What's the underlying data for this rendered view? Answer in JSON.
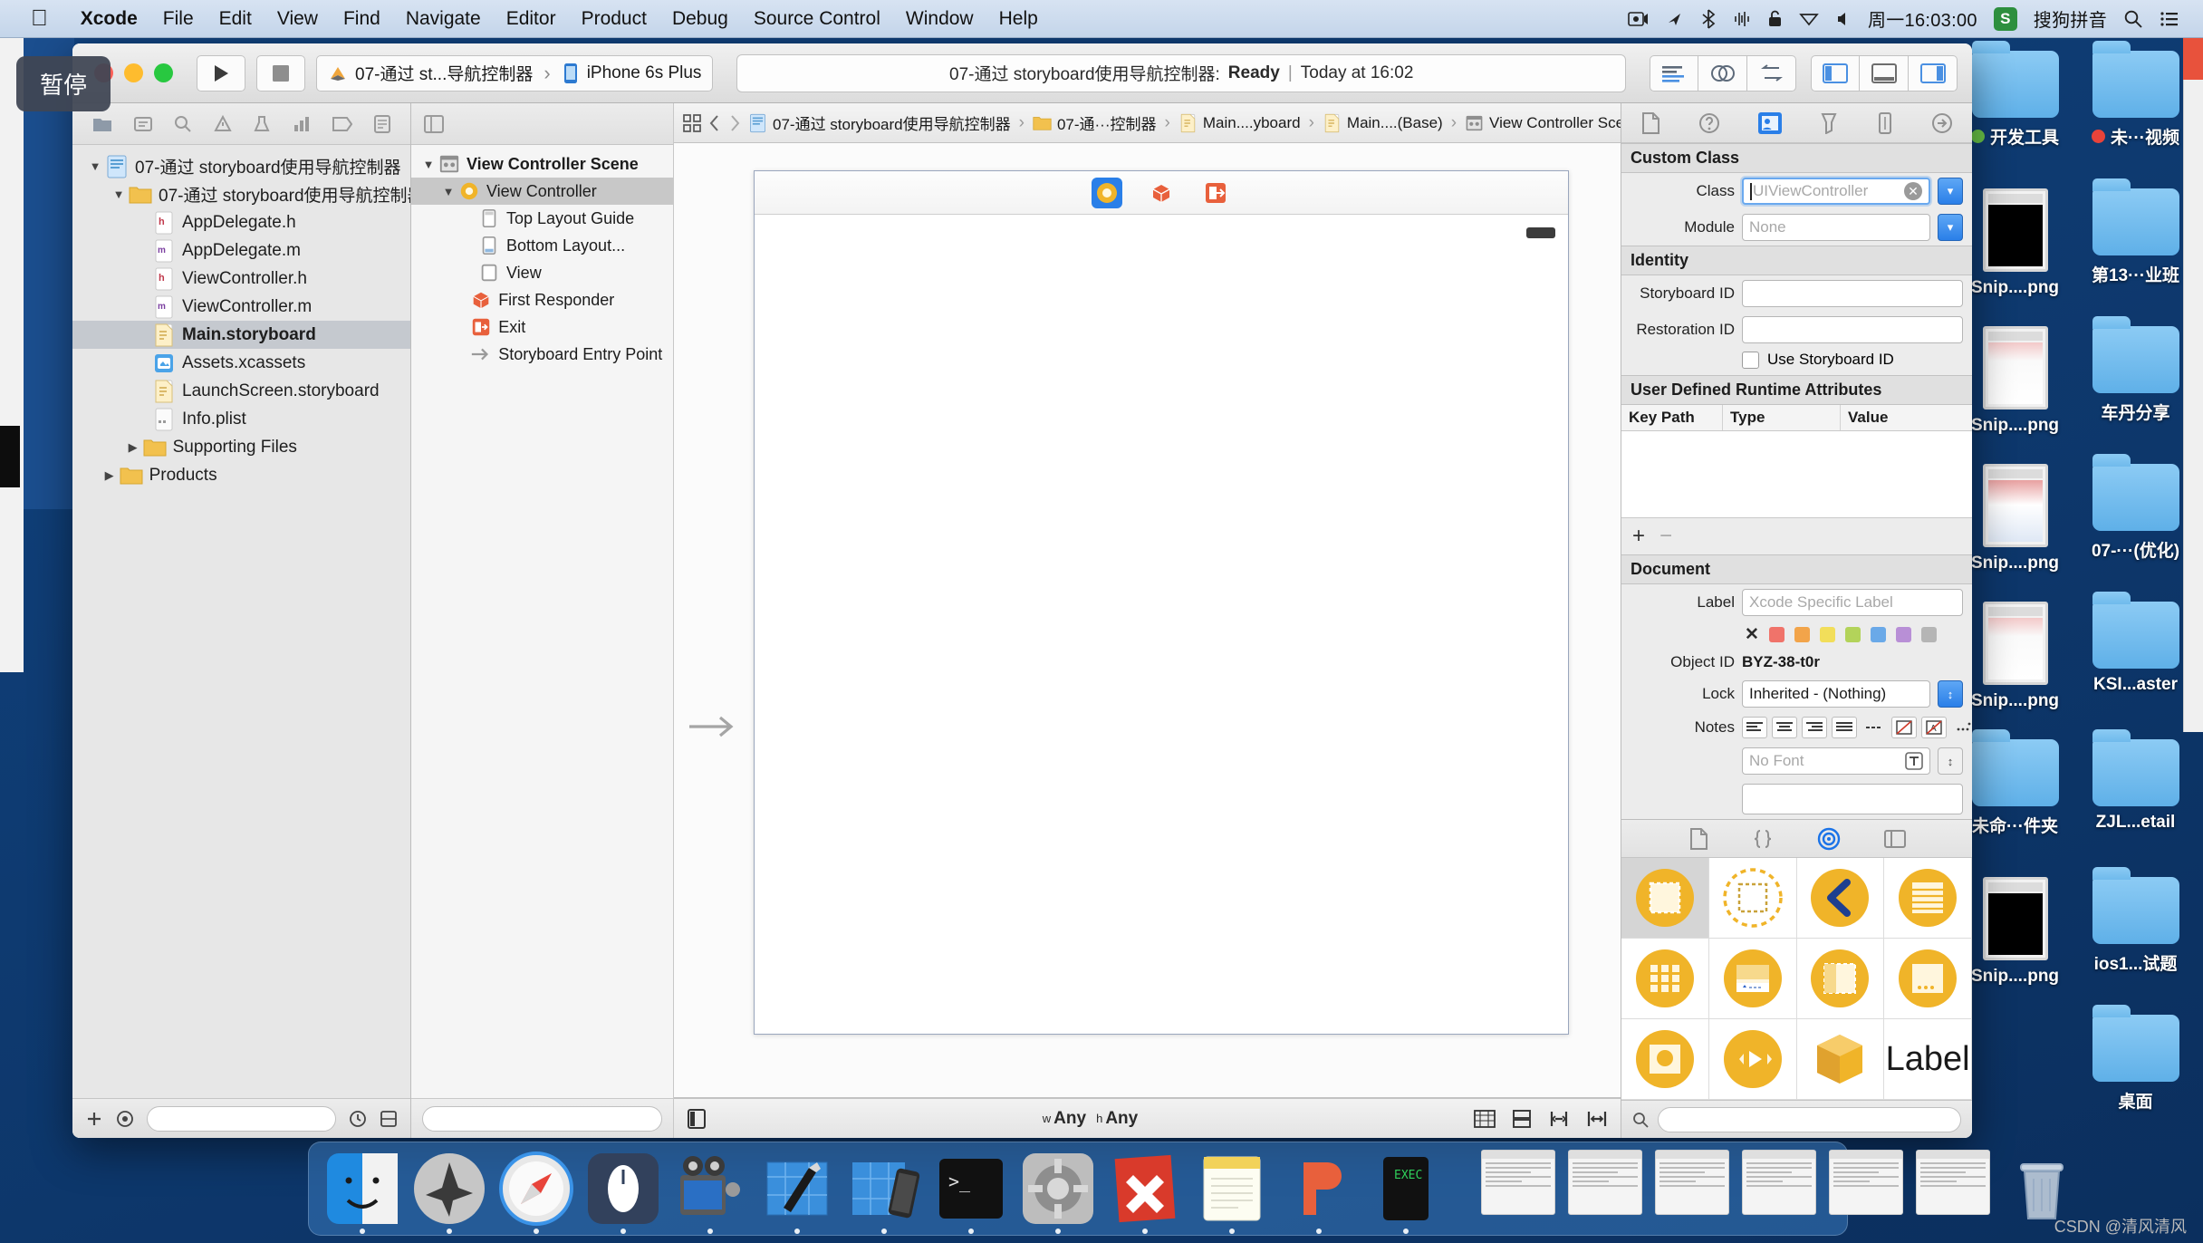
{
  "menubar": {
    "apple_icon": "apple-icon",
    "items": [
      {
        "label": "Xcode",
        "bold": true
      },
      {
        "label": "File",
        "bold": false
      },
      {
        "label": "Edit",
        "bold": false
      },
      {
        "label": "View",
        "bold": false
      },
      {
        "label": "Find",
        "bold": false
      },
      {
        "label": "Navigate",
        "bold": false
      },
      {
        "label": "Editor",
        "bold": false
      },
      {
        "label": "Product",
        "bold": false
      },
      {
        "label": "Debug",
        "bold": false
      },
      {
        "label": "Source Control",
        "bold": false
      },
      {
        "label": "Window",
        "bold": false
      },
      {
        "label": "Help",
        "bold": false
      }
    ],
    "status_icons": [
      "screen-record-icon",
      "airplay-icon",
      "bluetooth-icon",
      "sound-wave-icon",
      "lock-icon",
      "wifi-icon",
      "volume-icon"
    ],
    "clock": "周一16:03:00",
    "input_method_badge": "S",
    "input_method_label": "搜狗拼音",
    "search_icon": "search-icon",
    "notification_icon": "notification-center-icon"
  },
  "tooltip": {
    "text": "暂停"
  },
  "toolbar": {
    "traffic_lights": [
      "close",
      "minimize",
      "zoom"
    ],
    "run_button": "run-icon",
    "stop_button": "stop-icon",
    "scheme": {
      "target_icon": "xcode-project-icon",
      "target_label": "07-通过 st...导航控制器",
      "separator": "›",
      "device_icon": "iphone-icon",
      "device_label": "iPhone 6s Plus"
    },
    "status": {
      "project": "07-通过 storyboard使用导航控制器:",
      "state": "Ready",
      "divider": "|",
      "time": "Today at 16:02"
    },
    "editor_buttons": [
      "standard-editor-icon",
      "assistant-editor-icon",
      "version-editor-icon"
    ],
    "view_buttons": [
      "hide-navigator-icon",
      "hide-debug-area-icon",
      "hide-utilities-icon"
    ]
  },
  "navigator": {
    "tabs": [
      "project-navigator-icon",
      "symbol-navigator-icon",
      "find-navigator-icon",
      "issue-navigator-icon",
      "test-navigator-icon",
      "debug-navigator-icon",
      "breakpoint-navigator-icon",
      "report-navigator-icon"
    ],
    "tree": [
      {
        "label": "07-通过 storyboard使用导航控制器",
        "indent": 0,
        "twisty": "▼",
        "icon": "xcode-project-icon",
        "selected": false,
        "bold": false
      },
      {
        "label": "07-通过 storyboard使用导航控制器",
        "indent": 1,
        "twisty": "▼",
        "icon": "folder-icon",
        "selected": false,
        "bold": false
      },
      {
        "label": "AppDelegate.h",
        "indent": 2,
        "twisty": "",
        "icon": "header-file-icon",
        "selected": false,
        "bold": false
      },
      {
        "label": "AppDelegate.m",
        "indent": 2,
        "twisty": "",
        "icon": "source-file-icon",
        "selected": false,
        "bold": false
      },
      {
        "label": "ViewController.h",
        "indent": 2,
        "twisty": "",
        "icon": "header-file-icon",
        "selected": false,
        "bold": false
      },
      {
        "label": "ViewController.m",
        "indent": 2,
        "twisty": "",
        "icon": "source-file-icon",
        "selected": false,
        "bold": false
      },
      {
        "label": "Main.storyboard",
        "indent": 2,
        "twisty": "",
        "icon": "storyboard-file-icon",
        "selected": true,
        "bold": true
      },
      {
        "label": "Assets.xcassets",
        "indent": 2,
        "twisty": "",
        "icon": "assets-catalog-icon",
        "selected": false,
        "bold": false
      },
      {
        "label": "LaunchScreen.storyboard",
        "indent": 2,
        "twisty": "",
        "icon": "storyboard-file-icon",
        "selected": false,
        "bold": false
      },
      {
        "label": "Info.plist",
        "indent": 2,
        "twisty": "",
        "icon": "plist-file-icon",
        "selected": false,
        "bold": false
      },
      {
        "label": "Supporting Files",
        "indent": 1.6,
        "twisty": "▶",
        "icon": "folder-icon",
        "selected": false,
        "bold": false
      },
      {
        "label": "Products",
        "indent": 0.6,
        "twisty": "▶",
        "icon": "folder-icon",
        "selected": false,
        "bold": false
      }
    ],
    "bottom": {
      "add_icon": "add-icon",
      "filter_icon": "filter-icon",
      "filter_placeholder": "",
      "recent_icon": "recent-files-icon",
      "source-control_icon": "source-control-filter-icon"
    }
  },
  "outline": {
    "toolbar_icon": "document-outline-toggle-icon",
    "tree": [
      {
        "label": "View Controller Scene",
        "indent": 0,
        "twisty": "▼",
        "icon": "scene-icon",
        "selected": false,
        "bold": true
      },
      {
        "label": "View Controller",
        "indent": 1,
        "twisty": "▼",
        "icon": "view-controller-icon",
        "selected": true,
        "bold": false
      },
      {
        "label": "Top Layout Guide",
        "indent": 2,
        "twisty": "",
        "icon": "top-layout-guide-icon",
        "selected": false,
        "bold": false
      },
      {
        "label": "Bottom Layout...",
        "indent": 2,
        "twisty": "",
        "icon": "bottom-layout-guide-icon",
        "selected": false,
        "bold": false
      },
      {
        "label": "View",
        "indent": 2,
        "twisty": "",
        "icon": "view-icon",
        "selected": false,
        "bold": false
      },
      {
        "label": "First Responder",
        "indent": 1.6,
        "twisty": "",
        "icon": "first-responder-icon",
        "selected": false,
        "bold": false
      },
      {
        "label": "Exit",
        "indent": 1.6,
        "twisty": "",
        "icon": "exit-icon",
        "selected": false,
        "bold": false
      },
      {
        "label": "Storyboard Entry Point",
        "indent": 1.6,
        "twisty": "",
        "icon": "entry-point-arrow-icon",
        "selected": false,
        "bold": false
      }
    ],
    "filter_placeholder": ""
  },
  "jumpbar": {
    "grid_icon": "related-items-icon",
    "back_icon": "back-chevron-icon",
    "forward_icon": "forward-chevron-icon",
    "crumbs": [
      {
        "label": "07-通过 storyboard使用导航控制器",
        "icon": "xcode-project-icon"
      },
      {
        "label": "07-通···控制器",
        "icon": "folder-icon"
      },
      {
        "label": "Main....yboard",
        "icon": "storyboard-file-icon"
      },
      {
        "label": "Main....(Base)",
        "icon": "storyboard-file-icon"
      },
      {
        "label": "View Controller Scene",
        "icon": "scene-icon"
      },
      {
        "label": "View Controller",
        "icon": "view-controller-icon"
      }
    ],
    "separator": "›"
  },
  "canvas": {
    "entry_arrow": "storyboard-entry-arrow",
    "scene_dock": [
      {
        "icon": "view-controller-icon",
        "selected": true
      },
      {
        "icon": "first-responder-icon",
        "selected": false
      },
      {
        "icon": "exit-icon",
        "selected": false
      }
    ],
    "resize_handle": "resize-handle",
    "cursor": "mouse-pointer"
  },
  "editor_bottom": {
    "left_icon": "size-class-toggle-icon",
    "width_prefix": "w",
    "width_value": "Any",
    "height_prefix": "h",
    "height_value": "Any",
    "right_icons": [
      "constraints-icon",
      "embed-in-icon",
      "align-icon",
      "pin-icon"
    ]
  },
  "inspector": {
    "tabs": [
      "file-inspector-icon",
      "quick-help-icon",
      "identity-inspector-icon",
      "attributes-inspector-icon",
      "size-inspector-icon",
      "connections-inspector-icon"
    ],
    "active_tab_index": 2,
    "custom_class": {
      "title": "Custom Class",
      "class_label": "Class",
      "class_placeholder": "UIViewController",
      "class_value": "",
      "module_label": "Module",
      "module_placeholder": "None",
      "module_value": ""
    },
    "identity": {
      "title": "Identity",
      "storyboard_id_label": "Storyboard ID",
      "storyboard_id_value": "",
      "restoration_id_label": "Restoration ID",
      "restoration_id_value": "",
      "use_storyboard_id_label": "Use Storyboard ID",
      "use_storyboard_id_checked": false
    },
    "user_defined": {
      "title": "User Defined Runtime Attributes",
      "columns": [
        "Key Path",
        "Type",
        "Value"
      ],
      "rows": [],
      "add_icon": "plus-icon",
      "remove_icon": "minus-icon"
    },
    "document": {
      "title": "Document",
      "label_label": "Label",
      "label_placeholder": "Xcode Specific Label",
      "label_value": "",
      "swatch_clear": "✕",
      "swatches": [
        "#f0736a",
        "#f2a44a",
        "#f2de5a",
        "#b3d35a",
        "#6aa9e8",
        "#b88fd6",
        "#b5b5b5"
      ],
      "object_id_label": "Object ID",
      "object_id_value": "BYZ-38-t0r",
      "lock_label": "Lock",
      "lock_value": "Inherited - (Nothing)",
      "notes_label": "Notes",
      "notes_buttons": [
        "align-left-icon",
        "align-center-icon",
        "align-right-icon",
        "align-justify-icon",
        "list-icon",
        "no-color-icon",
        "no-text-color-icon",
        "more-icon"
      ],
      "font_placeholder": "No Font",
      "font_button_icon": "font-panel-icon",
      "notes_text": ""
    }
  },
  "library": {
    "tabs": [
      "file-template-library-icon",
      "code-snippet-library-icon",
      "object-library-icon",
      "media-library-icon"
    ],
    "active_tab_index": 2,
    "items": [
      {
        "name": "view-controller-object",
        "selected": true
      },
      {
        "name": "storyboard-reference-object",
        "selected": false
      },
      {
        "name": "navigation-controller-object",
        "selected": false
      },
      {
        "name": "table-view-controller-object",
        "selected": false
      },
      {
        "name": "collection-view-controller-object",
        "selected": false
      },
      {
        "name": "tab-bar-controller-object",
        "selected": false
      },
      {
        "name": "split-view-controller-object",
        "selected": false
      },
      {
        "name": "page-view-controller-object",
        "selected": false
      },
      {
        "name": "glkit-view-controller-object",
        "selected": false
      },
      {
        "name": "avkit-player-controller-object",
        "selected": false
      },
      {
        "name": "object-cube",
        "selected": false
      },
      {
        "name": "label-object",
        "selected": false,
        "text": "Label"
      }
    ],
    "filter_placeholder": "",
    "filter_icon": "search-icon"
  },
  "desktop": {
    "icons": [
      {
        "label": "开发工具",
        "type": "folder",
        "tag": "#69c447"
      },
      {
        "label": "未···视频",
        "type": "folder",
        "tag": "#e8433a"
      },
      {
        "label": "Snip....png",
        "type": "png-dark",
        "tag": ""
      },
      {
        "label": "第13···业班",
        "type": "folder",
        "tag": ""
      },
      {
        "label": "Snip....png",
        "type": "png-light",
        "tag": ""
      },
      {
        "label": "车丹分享",
        "type": "folder",
        "tag": ""
      },
      {
        "label": "Snip....png",
        "type": "png-mixed",
        "tag": ""
      },
      {
        "label": "07-···(优化)",
        "type": "folder",
        "tag": ""
      },
      {
        "label": "Snip....png",
        "type": "png-light",
        "tag": ""
      },
      {
        "label": "KSI...aster",
        "type": "folder",
        "tag": ""
      },
      {
        "label": "未命···件夹",
        "type": "folder",
        "tag": ""
      },
      {
        "label": "ZJL...etail",
        "type": "folder",
        "tag": ""
      },
      {
        "label": "Snip....png",
        "type": "png-dark",
        "tag": ""
      },
      {
        "label": "ios1...试题",
        "type": "folder",
        "tag": ""
      },
      {
        "label": "",
        "type": "none",
        "tag": ""
      },
      {
        "label": "桌面",
        "type": "folder",
        "tag": ""
      }
    ]
  },
  "dock": {
    "apps": [
      {
        "name": "finder-icon"
      },
      {
        "name": "launchpad-icon"
      },
      {
        "name": "safari-icon"
      },
      {
        "name": "mouse-app-icon"
      },
      {
        "name": "quicktime-icon"
      },
      {
        "name": "xcode-icon"
      },
      {
        "name": "simulator-icon"
      },
      {
        "name": "terminal-icon"
      },
      {
        "name": "system-preferences-icon"
      },
      {
        "name": "xmind-icon"
      },
      {
        "name": "notes-icon"
      },
      {
        "name": "pages-icon"
      },
      {
        "name": "exec-icon"
      }
    ],
    "minimized": [
      {
        "name": "minimized-window-1"
      },
      {
        "name": "minimized-window-2"
      },
      {
        "name": "minimized-window-3"
      },
      {
        "name": "minimized-window-4"
      },
      {
        "name": "minimized-window-5"
      },
      {
        "name": "minimized-window-6"
      }
    ],
    "trash": {
      "name": "trash-icon"
    }
  },
  "watermark": {
    "text": "CSDN @清风清风"
  }
}
